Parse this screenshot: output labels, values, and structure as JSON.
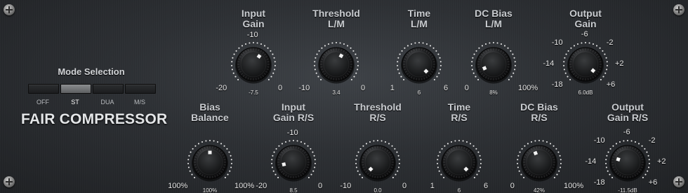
{
  "plugin": {
    "name": "FAIR COMPRESSOR",
    "mode_selection": {
      "title": "Mode Selection",
      "options": [
        "OFF",
        "ST",
        "DUA",
        "M/S"
      ],
      "selected": "ST"
    }
  },
  "knobs": [
    {
      "id": "input-gain-lm",
      "title": [
        "Input",
        "Gain"
      ],
      "min": "-20",
      "max": "0",
      "top": "-10",
      "readout": "-7.5",
      "fraction": 0.63
    },
    {
      "id": "threshold-lm",
      "title": [
        "Threshold",
        "L/M"
      ],
      "min": "-10",
      "max": "0",
      "readout": "3.4",
      "fraction": 0.61
    },
    {
      "id": "time-lm",
      "title": [
        "Time",
        "L/M"
      ],
      "min": "1",
      "max": "6",
      "readout": "6",
      "fraction": 1.0
    },
    {
      "id": "dc-bias-lm",
      "title": [
        "DC Bias",
        "L/M"
      ],
      "min": "0",
      "max": "100%",
      "readout": "8%",
      "fraction": 0.08
    },
    {
      "id": "output-gain-lm",
      "title": [
        "Output",
        "Gain"
      ],
      "scale": [
        {
          "t": "-18",
          "a": -135
        },
        {
          "t": "-14",
          "a": -90
        },
        {
          "t": "-10",
          "a": -45
        },
        {
          "t": "-6",
          "a": 0
        },
        {
          "t": "-2",
          "a": 45
        },
        {
          "t": "+2",
          "a": 90
        },
        {
          "t": "+6",
          "a": 135
        }
      ],
      "readout": "6.0dB",
      "fraction": 0.98
    },
    {
      "id": "bias-balance",
      "title": [
        "Bias",
        "Balance"
      ],
      "min": "100%",
      "max": "100%",
      "readout": "100%",
      "fraction": 0.5
    },
    {
      "id": "input-gain-rs",
      "title": [
        "Input",
        "Gain R/S"
      ],
      "min": "-20",
      "max": "0",
      "top": "-10",
      "readout": "8.5",
      "fraction": 0.12
    },
    {
      "id": "threshold-rs",
      "title": [
        "Threshold",
        "R/S"
      ],
      "min": "-10",
      "max": "0",
      "readout": "0.0",
      "fraction": 0.0
    },
    {
      "id": "time-rs",
      "title": [
        "Time",
        "R/S"
      ],
      "min": "1",
      "max": "6",
      "readout": "6",
      "fraction": 1.0
    },
    {
      "id": "dc-bias-rs",
      "title": [
        "DC Bias",
        "R/S"
      ],
      "min": "0",
      "max": "100%",
      "readout": "42%",
      "fraction": 0.42
    },
    {
      "id": "output-gain-rs",
      "title": [
        "Output",
        "Gain R/S"
      ],
      "scale": [
        {
          "t": "-18",
          "a": -135
        },
        {
          "t": "-14",
          "a": -90
        },
        {
          "t": "-10",
          "a": -45
        },
        {
          "t": "-6",
          "a": 0
        },
        {
          "t": "-2",
          "a": 45
        },
        {
          "t": "+2",
          "a": 90
        },
        {
          "t": "+6",
          "a": 135
        }
      ],
      "readout": "-11.5dB",
      "fraction": 0.23
    }
  ]
}
